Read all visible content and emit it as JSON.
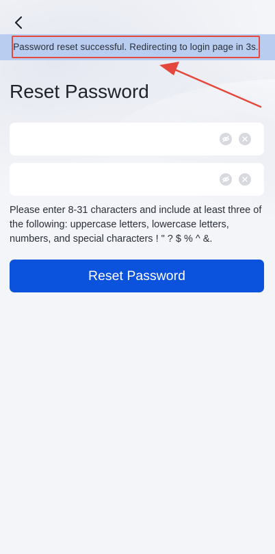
{
  "nav": {
    "back_icon": "chevron-left-icon"
  },
  "toast": {
    "message": "Password reset successful. Redirecting to login page in 3s.",
    "background_color": "#b8cdef",
    "highlight_color": "#e4473b"
  },
  "page": {
    "title": "Reset Password"
  },
  "form": {
    "new_password": {
      "value": "",
      "placeholder": "",
      "visibility_icon": "eye-off-icon",
      "clear_icon": "clear-icon"
    },
    "confirm_password": {
      "value": "",
      "placeholder": "",
      "visibility_icon": "eye-off-icon",
      "clear_icon": "clear-icon"
    },
    "hint": "Please enter 8-31 characters and include at least three of the following: uppercase letters, lowercase letters, numbers, and special characters ! \" ? $ % ^ &.",
    "submit_label": "Reset Password",
    "submit_color": "#0b52dc"
  }
}
